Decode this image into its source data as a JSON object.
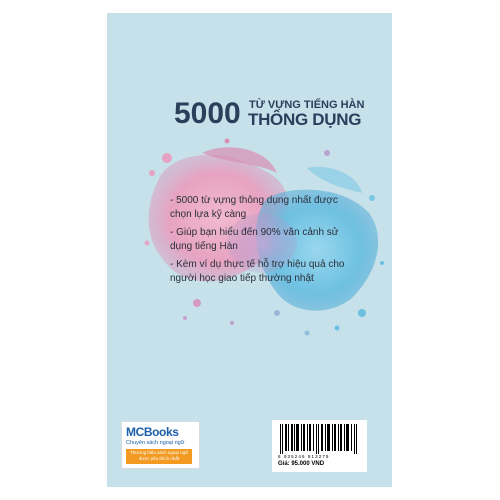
{
  "cover": {
    "title_number": "5000",
    "title_line1": "TỪ VỰNG TIẾNG HÀN",
    "title_line2": "THÔNG DỤNG",
    "bullets": [
      "- 5000 từ vựng thông dụng nhất được chọn lựa kỹ càng",
      "- Giúp bạn hiểu đến 90% văn cảnh sử dụng tiếng Hàn",
      "- Kèm ví dụ thực tế hỗ trợ hiệu quả cho người học giao tiếp thường nhật"
    ],
    "background_color": "#c7e1ea"
  },
  "publisher": {
    "logo": "MCBooks",
    "subtitle": "Chuyên sách ngoại ngữ",
    "tagline": "Thương hiệu sách ngoại ngữ được yêu thích nhất"
  },
  "barcode": {
    "number": "8 935246 913279",
    "price": "Giá: 95.000 VND"
  }
}
